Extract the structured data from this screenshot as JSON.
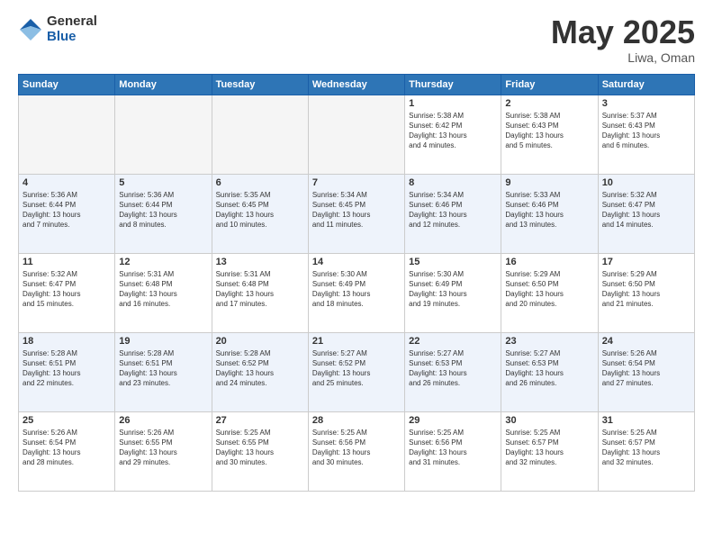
{
  "header": {
    "logo_general": "General",
    "logo_blue": "Blue",
    "title": "May 2025",
    "location": "Liwa, Oman"
  },
  "days_of_week": [
    "Sunday",
    "Monday",
    "Tuesday",
    "Wednesday",
    "Thursday",
    "Friday",
    "Saturday"
  ],
  "weeks": [
    [
      {
        "day": "",
        "info": ""
      },
      {
        "day": "",
        "info": ""
      },
      {
        "day": "",
        "info": ""
      },
      {
        "day": "",
        "info": ""
      },
      {
        "day": "1",
        "info": "Sunrise: 5:38 AM\nSunset: 6:42 PM\nDaylight: 13 hours\nand 4 minutes."
      },
      {
        "day": "2",
        "info": "Sunrise: 5:38 AM\nSunset: 6:43 PM\nDaylight: 13 hours\nand 5 minutes."
      },
      {
        "day": "3",
        "info": "Sunrise: 5:37 AM\nSunset: 6:43 PM\nDaylight: 13 hours\nand 6 minutes."
      }
    ],
    [
      {
        "day": "4",
        "info": "Sunrise: 5:36 AM\nSunset: 6:44 PM\nDaylight: 13 hours\nand 7 minutes."
      },
      {
        "day": "5",
        "info": "Sunrise: 5:36 AM\nSunset: 6:44 PM\nDaylight: 13 hours\nand 8 minutes."
      },
      {
        "day": "6",
        "info": "Sunrise: 5:35 AM\nSunset: 6:45 PM\nDaylight: 13 hours\nand 10 minutes."
      },
      {
        "day": "7",
        "info": "Sunrise: 5:34 AM\nSunset: 6:45 PM\nDaylight: 13 hours\nand 11 minutes."
      },
      {
        "day": "8",
        "info": "Sunrise: 5:34 AM\nSunset: 6:46 PM\nDaylight: 13 hours\nand 12 minutes."
      },
      {
        "day": "9",
        "info": "Sunrise: 5:33 AM\nSunset: 6:46 PM\nDaylight: 13 hours\nand 13 minutes."
      },
      {
        "day": "10",
        "info": "Sunrise: 5:32 AM\nSunset: 6:47 PM\nDaylight: 13 hours\nand 14 minutes."
      }
    ],
    [
      {
        "day": "11",
        "info": "Sunrise: 5:32 AM\nSunset: 6:47 PM\nDaylight: 13 hours\nand 15 minutes."
      },
      {
        "day": "12",
        "info": "Sunrise: 5:31 AM\nSunset: 6:48 PM\nDaylight: 13 hours\nand 16 minutes."
      },
      {
        "day": "13",
        "info": "Sunrise: 5:31 AM\nSunset: 6:48 PM\nDaylight: 13 hours\nand 17 minutes."
      },
      {
        "day": "14",
        "info": "Sunrise: 5:30 AM\nSunset: 6:49 PM\nDaylight: 13 hours\nand 18 minutes."
      },
      {
        "day": "15",
        "info": "Sunrise: 5:30 AM\nSunset: 6:49 PM\nDaylight: 13 hours\nand 19 minutes."
      },
      {
        "day": "16",
        "info": "Sunrise: 5:29 AM\nSunset: 6:50 PM\nDaylight: 13 hours\nand 20 minutes."
      },
      {
        "day": "17",
        "info": "Sunrise: 5:29 AM\nSunset: 6:50 PM\nDaylight: 13 hours\nand 21 minutes."
      }
    ],
    [
      {
        "day": "18",
        "info": "Sunrise: 5:28 AM\nSunset: 6:51 PM\nDaylight: 13 hours\nand 22 minutes."
      },
      {
        "day": "19",
        "info": "Sunrise: 5:28 AM\nSunset: 6:51 PM\nDaylight: 13 hours\nand 23 minutes."
      },
      {
        "day": "20",
        "info": "Sunrise: 5:28 AM\nSunset: 6:52 PM\nDaylight: 13 hours\nand 24 minutes."
      },
      {
        "day": "21",
        "info": "Sunrise: 5:27 AM\nSunset: 6:52 PM\nDaylight: 13 hours\nand 25 minutes."
      },
      {
        "day": "22",
        "info": "Sunrise: 5:27 AM\nSunset: 6:53 PM\nDaylight: 13 hours\nand 26 minutes."
      },
      {
        "day": "23",
        "info": "Sunrise: 5:27 AM\nSunset: 6:53 PM\nDaylight: 13 hours\nand 26 minutes."
      },
      {
        "day": "24",
        "info": "Sunrise: 5:26 AM\nSunset: 6:54 PM\nDaylight: 13 hours\nand 27 minutes."
      }
    ],
    [
      {
        "day": "25",
        "info": "Sunrise: 5:26 AM\nSunset: 6:54 PM\nDaylight: 13 hours\nand 28 minutes."
      },
      {
        "day": "26",
        "info": "Sunrise: 5:26 AM\nSunset: 6:55 PM\nDaylight: 13 hours\nand 29 minutes."
      },
      {
        "day": "27",
        "info": "Sunrise: 5:25 AM\nSunset: 6:55 PM\nDaylight: 13 hours\nand 30 minutes."
      },
      {
        "day": "28",
        "info": "Sunrise: 5:25 AM\nSunset: 6:56 PM\nDaylight: 13 hours\nand 30 minutes."
      },
      {
        "day": "29",
        "info": "Sunrise: 5:25 AM\nSunset: 6:56 PM\nDaylight: 13 hours\nand 31 minutes."
      },
      {
        "day": "30",
        "info": "Sunrise: 5:25 AM\nSunset: 6:57 PM\nDaylight: 13 hours\nand 32 minutes."
      },
      {
        "day": "31",
        "info": "Sunrise: 5:25 AM\nSunset: 6:57 PM\nDaylight: 13 hours\nand 32 minutes."
      }
    ]
  ]
}
